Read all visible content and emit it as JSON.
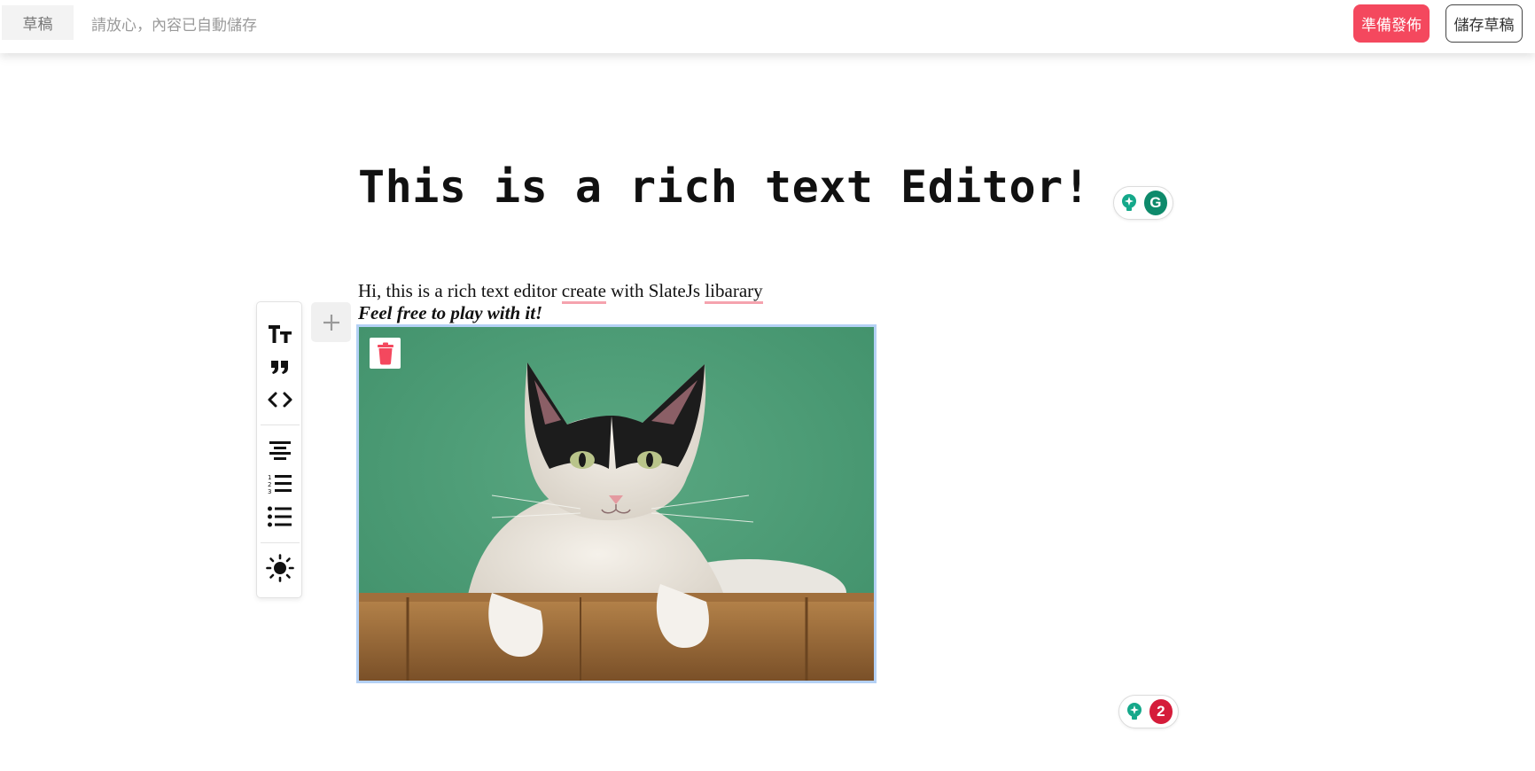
{
  "header": {
    "draft_label": "草稿",
    "autosave_text": "請放心，內容已自動儲存",
    "publish_label": "準備發佈",
    "save_draft_label": "儲存草稿"
  },
  "editor": {
    "title": "This is a rich text Editor!",
    "paragraph": {
      "part1": "Hi, this is a rich text editor ",
      "flag1": "create",
      "part2": " with SlateJs ",
      "flag2": "libarary"
    },
    "emphasis_line": "Feel free to play with it!"
  },
  "toolbar": {
    "items": [
      {
        "icon": "text-size-icon"
      },
      {
        "icon": "quote-icon"
      },
      {
        "icon": "code-icon"
      },
      {
        "icon": "align-center-icon"
      },
      {
        "icon": "numbered-list-icon"
      },
      {
        "icon": "bulleted-list-icon"
      },
      {
        "icon": "theme-toggle-icon"
      }
    ],
    "add_block_icon": "plus-icon"
  },
  "image_block": {
    "delete_icon": "trash-icon"
  },
  "grammarly": {
    "top_logo": "G",
    "bottom_count": "2"
  },
  "colors": {
    "accent": "#f4485e",
    "grammarly_green": "#0e8a6b",
    "grammarly_red": "#d51c3a",
    "image_border": "#b4d1f5",
    "spell_underline": "#f5a3ae"
  }
}
